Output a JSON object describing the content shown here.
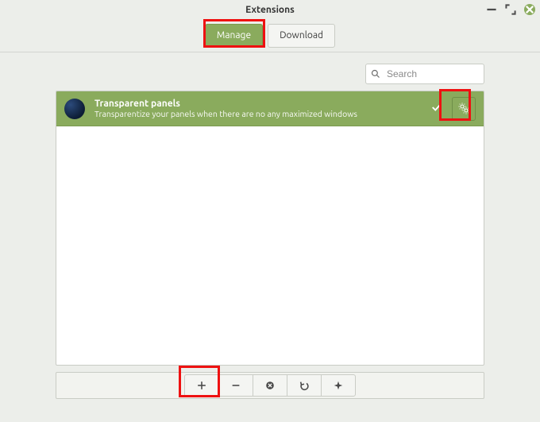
{
  "window": {
    "title": "Extensions"
  },
  "tabs": {
    "manage": "Manage",
    "download": "Download",
    "active": "manage"
  },
  "search": {
    "placeholder": "Search"
  },
  "extension": {
    "title": "Transparent panels",
    "description": "Transparentize your panels when there are no any maximized windows",
    "enabled": true
  }
}
